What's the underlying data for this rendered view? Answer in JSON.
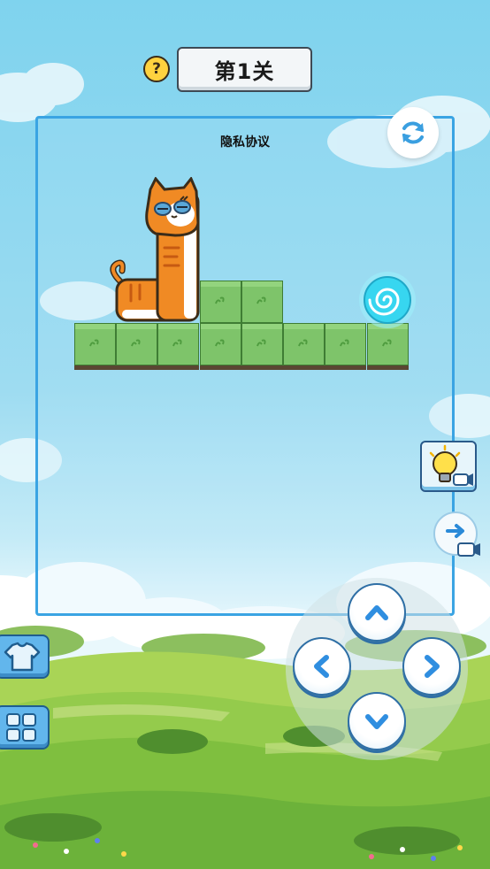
{
  "header": {
    "help_icon_text": "?",
    "level_label": "第1关"
  },
  "board": {
    "privacy_link": "隐私协议",
    "restart_icon": "refresh-icon"
  },
  "characters": {
    "cat": "orange-cat-snake",
    "portal": "cyan-swirl-portal"
  },
  "controls": {
    "hint_icon": "lightbulb-video-icon",
    "skip_icon": "arrow-right-video-icon",
    "skin_icon": "tshirt-icon",
    "menu_icon": "grid-icon",
    "dpad": [
      "up",
      "left",
      "right",
      "down"
    ]
  },
  "colors": {
    "board_border": "#3aa4e3",
    "grass": "#7ec46a",
    "cat_orange": "#f08a24",
    "portal": "#37d6f0",
    "button_blue": "#62b6ec"
  }
}
